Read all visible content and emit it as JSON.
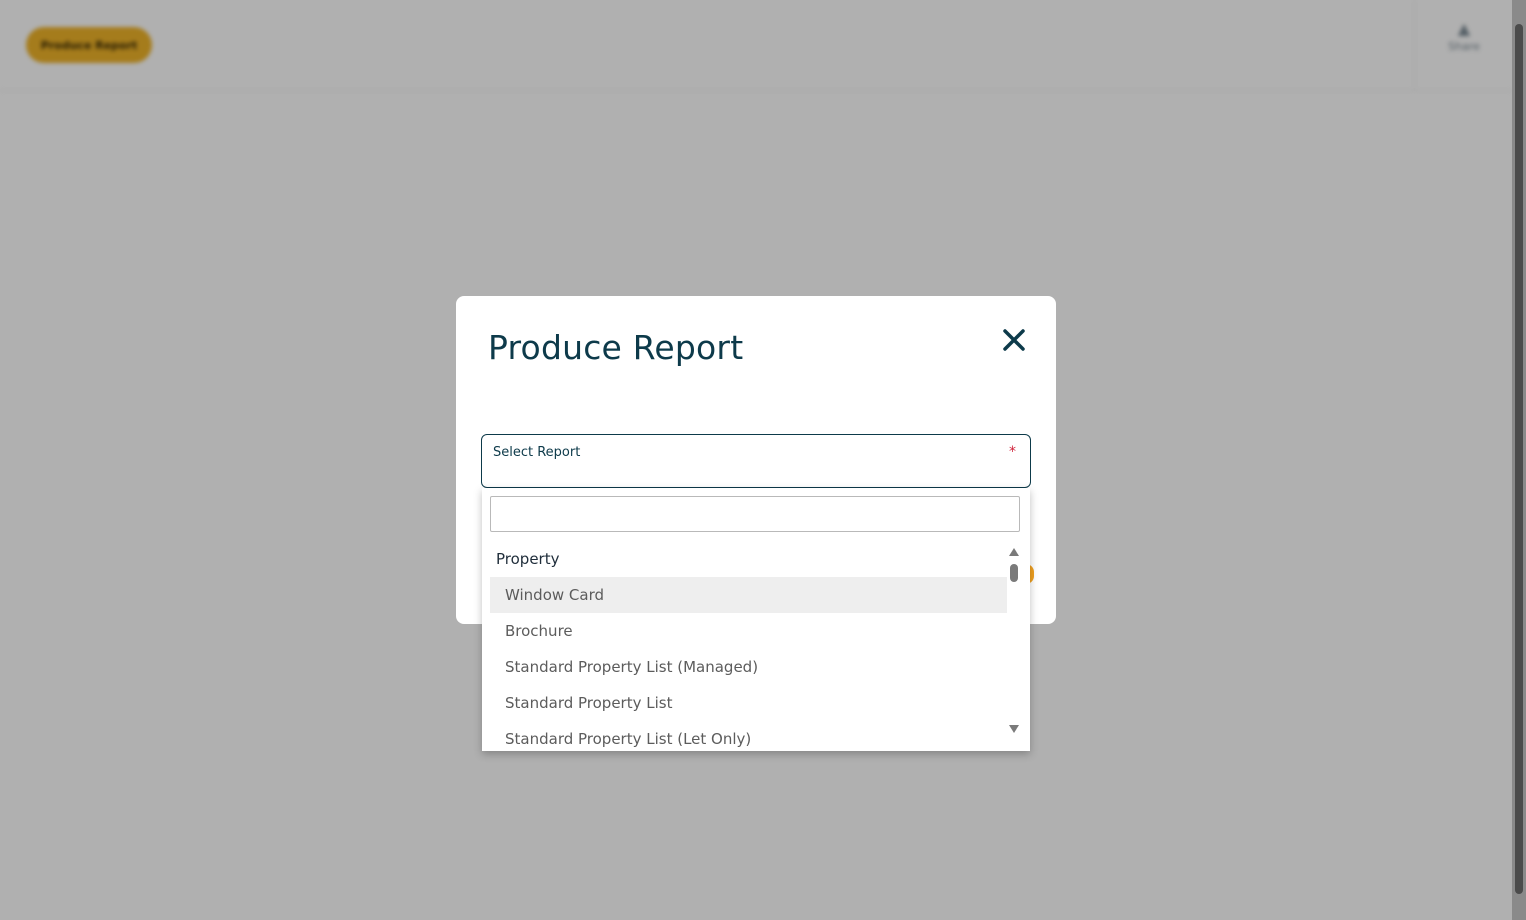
{
  "background": {
    "header_button_label": "Produce Report",
    "share_label": "Share"
  },
  "modal": {
    "title": "Produce Report",
    "select_label": "Select Report",
    "required_mark": "*"
  },
  "dropdown": {
    "search_value": "",
    "group_label": "Property",
    "options": [
      {
        "label": "Window Card",
        "highlighted": true
      },
      {
        "label": "Brochure",
        "highlighted": false
      },
      {
        "label": "Standard Property List (Managed)",
        "highlighted": false
      },
      {
        "label": "Standard Property List",
        "highlighted": false
      },
      {
        "label": "Standard Property List (Let Only)",
        "highlighted": false
      }
    ]
  },
  "colors": {
    "brand_dark": "#0d3a4a",
    "accent_orange": "#f0b429",
    "required_red": "#d0223a",
    "highlight": "#eeeeee"
  }
}
